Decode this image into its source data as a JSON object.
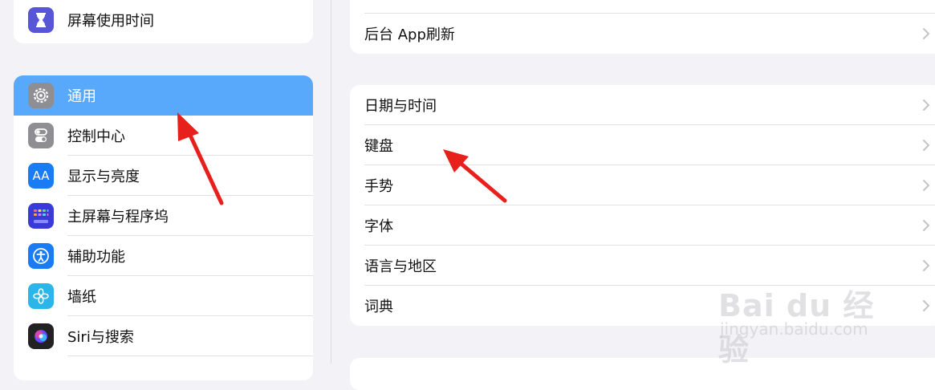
{
  "sidebar": {
    "top_item": {
      "label": "屏幕使用时间",
      "icon": "hourglass-icon",
      "color": "#5856d6"
    },
    "items": [
      {
        "label": "通用",
        "icon": "gear-icon",
        "color": "#8e8e93",
        "selected": true
      },
      {
        "label": "控制中心",
        "icon": "toggles-icon",
        "color": "#8e8e93"
      },
      {
        "label": "显示与亮度",
        "icon": "text-size-icon",
        "color": "#1a7cf5",
        "glyph": "AA"
      },
      {
        "label": "主屏幕与程序坞",
        "icon": "home-grid-icon",
        "color": "#3a3ad6"
      },
      {
        "label": "辅助功能",
        "icon": "accessibility-icon",
        "color": "#1a7cf5"
      },
      {
        "label": "墙纸",
        "icon": "flower-icon",
        "color": "#2bb5e8"
      },
      {
        "label": "Siri与搜索",
        "icon": "siri-icon",
        "color": "#222222"
      }
    ],
    "selected_color": "#58a8fb"
  },
  "main": {
    "group1": {
      "partial_label": "",
      "items": [
        {
          "label": "后台 App刷新"
        }
      ]
    },
    "group2": {
      "items": [
        {
          "label": "日期与时间"
        },
        {
          "label": "键盘"
        },
        {
          "label": "手势"
        },
        {
          "label": "字体"
        },
        {
          "label": "语言与地区"
        },
        {
          "label": "词典"
        }
      ]
    }
  },
  "watermark": {
    "logo": "Bai du 经验",
    "url": "jingyan.baidu.com"
  },
  "annotation_color": "#e8201c"
}
